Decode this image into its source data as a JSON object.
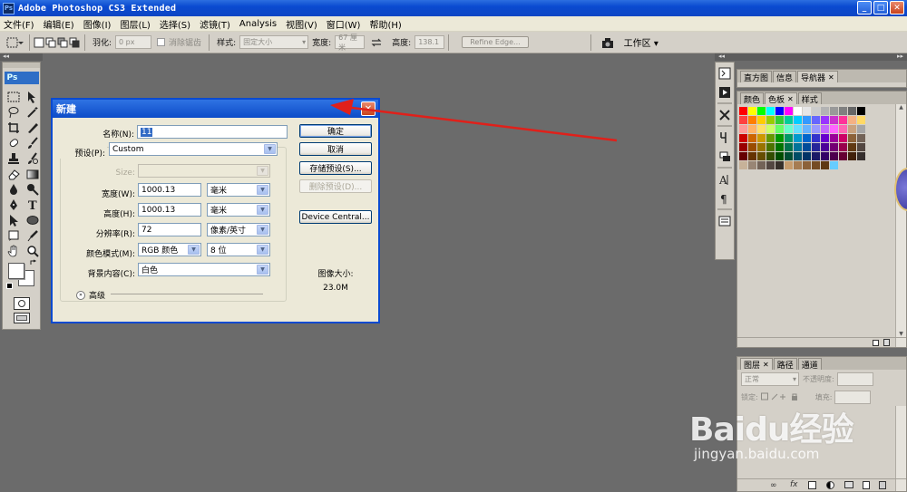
{
  "window": {
    "title": "Adobe Photoshop CS3 Extended",
    "app_icon": "Ps",
    "buttons": {
      "minimize": "_",
      "restore": "□",
      "close": "✕"
    }
  },
  "menu": [
    "文件(F)",
    "编辑(E)",
    "图像(I)",
    "图层(L)",
    "选择(S)",
    "滤镜(T)",
    "Analysis",
    "视图(V)",
    "窗口(W)",
    "帮助(H)"
  ],
  "options_bar": {
    "feather_label": "羽化:",
    "feather_value": "0 px",
    "antialias_label": "消除锯齿",
    "style_label": "样式:",
    "style_value": "固定大小",
    "width_label": "宽度:",
    "width_value": "67 厘米",
    "height_label": "高度:",
    "height_value": "138.1",
    "refine_edge": "Refine Edge...",
    "workspace": "工作区 ▾"
  },
  "toolbox": {
    "logo": "Ps",
    "collapse": "◂◂"
  },
  "dialog": {
    "title": "新建",
    "name_label": "名称(N):",
    "name_value": "11",
    "preset_label": "预设(P):",
    "preset_value": "Custom",
    "size_label": "Size:",
    "width_label": "宽度(W):",
    "width_value": "1000.13",
    "width_unit": "毫米",
    "height_label": "高度(H):",
    "height_value": "1000.13",
    "height_unit": "毫米",
    "resolution_label": "分辨率(R):",
    "resolution_value": "72",
    "resolution_unit": "像素/英寸",
    "color_mode_label": "颜色模式(M):",
    "color_mode_value": "RGB 颜色",
    "bit_depth": "8 位",
    "background_label": "背景内容(C):",
    "background_value": "白色",
    "advanced": "高级",
    "image_size_label": "图像大小:",
    "image_size_value": "23.0M",
    "buttons": {
      "ok": "确定",
      "cancel": "取消",
      "save_preset": "存储预设(S)...",
      "delete_preset": "删除预设(D)...",
      "device_central": "Device Central..."
    }
  },
  "panels": {
    "top_tabs": [
      "直方图",
      "信息",
      "导航器"
    ],
    "color_tabs": [
      "颜色",
      "色板",
      "样式"
    ],
    "layer_tabs": [
      "图层",
      "路径",
      "通道"
    ],
    "blend_mode": "正常",
    "opacity_label": "不透明度:",
    "lock_label": "锁定:",
    "fill_label": "填充:",
    "collapse": "◂◂"
  },
  "watermark": {
    "main": "Baidu经验",
    "sub": "jingyan.baidu.com"
  },
  "colors": {
    "titlebar": "#0a4ad0",
    "arrow": "#e0201a",
    "swatches_row1": [
      "#ff0000",
      "#ffff00",
      "#00ff00",
      "#00ffff",
      "#0000ff",
      "#ff00ff",
      "#ffffff",
      "#e6e6e6",
      "#cccccc",
      "#b3b3b3",
      "#999999",
      "#808080",
      "#666666",
      "#000000"
    ]
  }
}
